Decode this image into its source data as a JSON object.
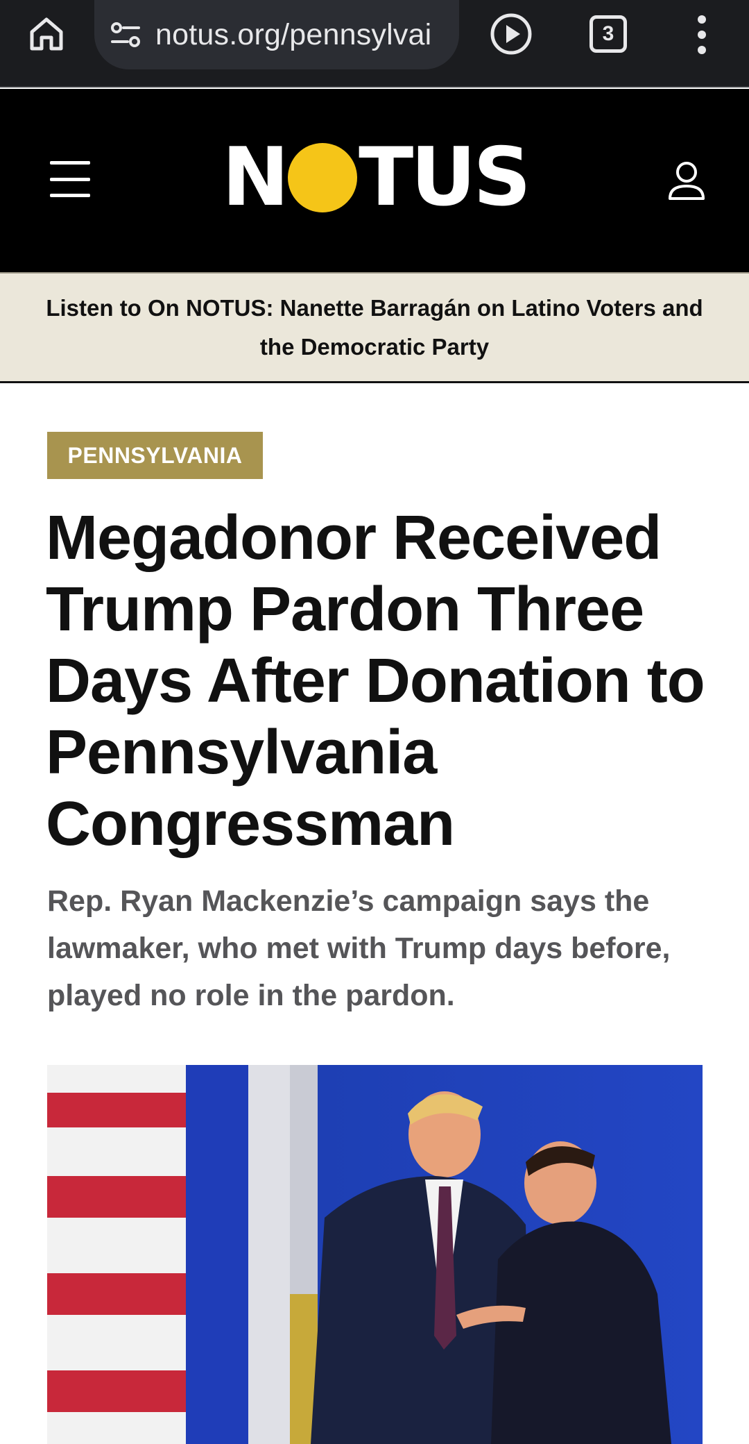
{
  "browser": {
    "url": "notus.org/pennsylvai",
    "tab_count": "3",
    "icons": [
      "home-icon",
      "site-settings-icon",
      "play-icon",
      "tabs-icon",
      "more-vert-icon"
    ]
  },
  "site": {
    "logo_left": "N",
    "logo_right": "TUS",
    "logo_accent_color": "#f5c518",
    "header_bg": "#000000"
  },
  "promo": {
    "text": "Listen to On NOTUS: Nanette Barragán on Latino Voters and the Democratic Party"
  },
  "article": {
    "category": "PENNSYLVANIA",
    "category_color": "#a8944f",
    "headline": "Megadonor Received Trump Pardon Three Days After Donation to Pennsylvania Congressman",
    "dek": "Rep. Ryan Mackenzie’s campaign says the lawmaker, who met with Trump days before, played no role in the pardon."
  }
}
